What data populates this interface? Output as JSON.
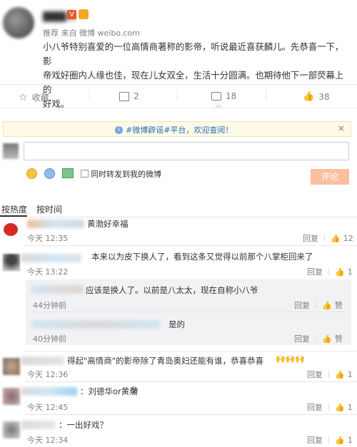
{
  "post": {
    "user_name_blurred": "▇▇▇晶",
    "source_prefix": "推荐 来自",
    "source": "微博 weibo.com",
    "text_line1": "小八爷特别喜爱的一位高情商著称的影帝，听说最近喜获麟儿。先恭喜一下，影",
    "text_line2": "帝戏好圈内人缘也佳，现在儿女双全，生活十分圆满。也期待他下一部荧幕上的",
    "text_line3": "好戏。"
  },
  "actions": {
    "favorite_label": "收藏",
    "repost_count": "2",
    "comment_count": "18",
    "like_count": "38"
  },
  "banner": {
    "text": "#微博辟谣#平台，欢迎查阅！"
  },
  "composer": {
    "placeholder": "",
    "checkbox_label": "同时转发到我的微博",
    "submit_label": "评论"
  },
  "sort_tabs": {
    "hot": "按热度",
    "time": "按时间"
  },
  "comments": [
    {
      "text": "黄渤好幸福",
      "time": "今天 12:35",
      "reply": "回复",
      "likes": "12"
    },
    {
      "text": "本来以为皮下换人了，看到这条又觉得以前那个八掌柜回来了",
      "time": "今天 13:22",
      "reply": "回复",
      "likes": "1",
      "replies": [
        {
          "text": "应该是换人了。以前是八太太，现在自称小八爷",
          "time": "44分钟前",
          "reply": "回复",
          "likes": "赞"
        },
        {
          "text": "是的",
          "time": "40分钟前",
          "reply": "回复",
          "likes": "赞"
        }
      ]
    },
    {
      "text": "得起\"高情商\"的影帝除了青岛奥妇还能有谁，恭喜恭喜",
      "time": "今天 12:36",
      "reply": "回复",
      "likes": "1"
    },
    {
      "text": "：刘德华or黄渤",
      "time": "今天 12:45",
      "reply": "回复",
      "likes": "1"
    },
    {
      "text": "：一出好戏？",
      "time": "今天 12:34",
      "reply": "回复",
      "likes": "1"
    }
  ]
}
